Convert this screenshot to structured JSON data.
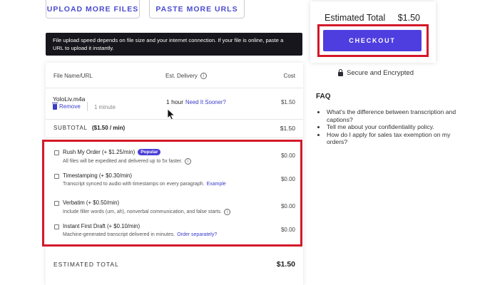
{
  "top_buttons": {
    "upload": "UPLOAD MORE FILES",
    "paste": "PASTE MORE URLS"
  },
  "notice": "File upload speed depends on file size and your internet connection. If your file is online, paste a URL to upload it instantly.",
  "table": {
    "headers": {
      "name": "File Name/URL",
      "delivery": "Est. Delivery",
      "cost": "Cost"
    },
    "file": {
      "name": "YoloLiv.m4a",
      "remove": "Remove",
      "duration": "1 minute",
      "delivery": "1 hour",
      "need_sooner": "Need It Sooner?",
      "cost": "$1.50"
    },
    "subtotal": {
      "label": "SUBTOTAL",
      "rate": "($1.50 / min)",
      "value": "$1.50"
    },
    "addons": [
      {
        "title": "Rush My Order (+ $1.25/min)",
        "badge": "Popular",
        "desc": "All files will be expedited and delivered up to 5x faster.",
        "link": "",
        "cost": "$0.00"
      },
      {
        "title": "Timestamping (+ $0.30/min)",
        "badge": "",
        "desc": "Transcript synced to audio with timestamps on every paragraph.",
        "link": "Example",
        "cost": "$0.00"
      },
      {
        "title": "Verbatim (+ $0.50/min)",
        "badge": "",
        "desc": "Include filler words (um, ah), nonverbal communication, and false starts.",
        "link": "",
        "cost": "$0.00"
      },
      {
        "title": "Instant First Draft (+ $0.10/min)",
        "badge": "",
        "desc": "Machine-generated transcript delivered in minutes.",
        "link": "Order separately?",
        "cost": "$0.00"
      }
    ],
    "estimated": {
      "label": "ESTIMATED TOTAL",
      "value": "$1.50"
    }
  },
  "summary": {
    "label": "Estimated Total",
    "value": "$1.50",
    "checkout": "CHECKOUT"
  },
  "secure": "Secure and Encrypted",
  "faq": {
    "title": "FAQ",
    "items": [
      "What's the difference between transcription and captions?",
      "Tell me about your confidentiality policy.",
      "How do I apply for sales tax exemption on my orders?"
    ]
  },
  "colors": {
    "accent": "#4e3ee0",
    "link": "#3b3bc8",
    "highlight": "#d4182a"
  },
  "icons": [
    "info-icon",
    "trash-icon",
    "lock-icon",
    "mouse-cursor-icon",
    "checkbox-icon"
  ]
}
